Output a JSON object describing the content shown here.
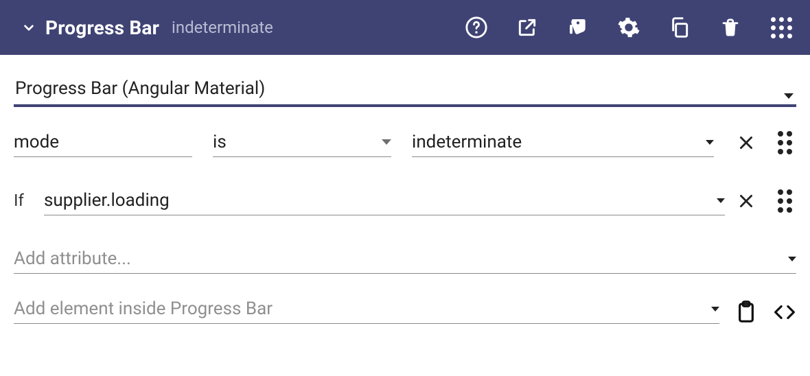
{
  "header": {
    "title": "Progress Bar",
    "subtitle": "indeterminate"
  },
  "tab": {
    "label": "Progress Bar (Angular Material)"
  },
  "attr_row": {
    "name": "mode",
    "op": "is",
    "value": "indeterminate"
  },
  "cond_row": {
    "prefix": "If",
    "expr": "supplier.loading"
  },
  "add_attr": {
    "placeholder": "Add attribute..."
  },
  "add_child": {
    "placeholder": "Add element inside Progress Bar"
  }
}
